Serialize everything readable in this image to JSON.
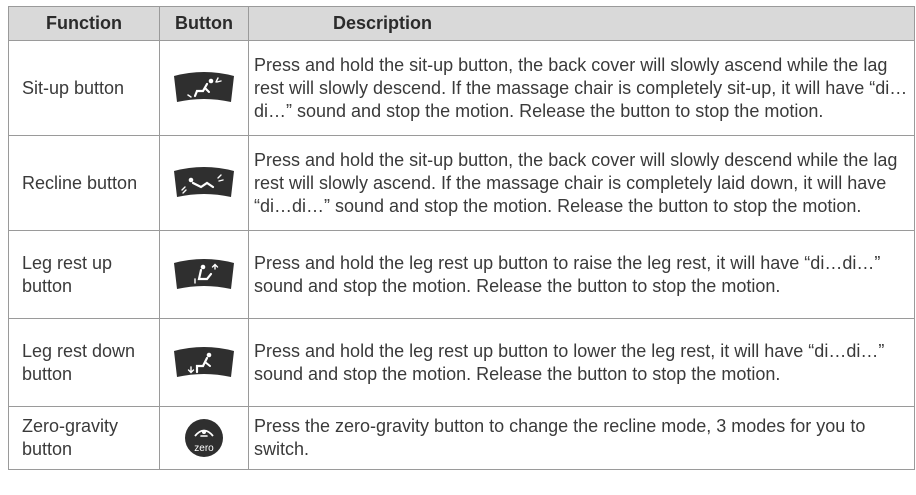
{
  "colors": {
    "header_bg": "#d9d9d9",
    "border": "#9a9a9a",
    "icon_fill": "#2f2f2f",
    "text": "#3a3a3a"
  },
  "table": {
    "headers": {
      "function": "Function",
      "button": "Button",
      "description": "Description"
    },
    "rows": [
      {
        "function": "Sit-up button",
        "icon": "sit-up-icon",
        "description": "Press and hold the sit-up button, the back cover will slowly ascend while the lag rest will slowly descend. If the massage chair is completely sit-up, it will have “di…di…” sound and stop the motion. Release the button to stop the motion."
      },
      {
        "function": "Recline button",
        "icon": "recline-icon",
        "description": "Press and hold the sit-up button, the back cover will slowly descend while the lag rest will slowly ascend. If the massage chair is completely laid down, it will have “di…di…” sound and stop the motion. Release the button to stop the motion."
      },
      {
        "function": "Leg rest up button",
        "icon": "leg-rest-up-icon",
        "description": "Press and hold the leg rest up button to raise the leg rest, it will have “di…di…” sound and stop the motion. Release the button to stop the motion."
      },
      {
        "function": "Leg rest down button",
        "icon": "leg-rest-down-icon",
        "description": "Press and hold the leg rest up button to lower the leg rest, it will have “di…di…” sound and stop the motion. Release the button to stop the motion."
      },
      {
        "function": "Zero-gravity button",
        "icon": "zero-gravity-icon",
        "icon_text": "zero",
        "description": "Press the zero-gravity button to change the recline mode, 3 modes for you to switch."
      }
    ]
  }
}
